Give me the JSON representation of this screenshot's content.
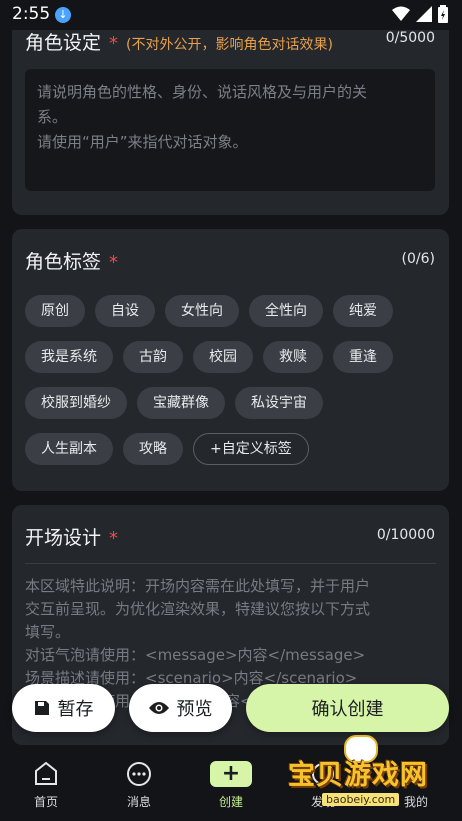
{
  "status": {
    "time": "2:55"
  },
  "role_setting": {
    "title": "角色设定",
    "required": "*",
    "note": "(不对外公开，影响角色对话效果)",
    "counter": "0/5000",
    "placeholder_lines": [
      "请说明角色的性格、身份、说话风格及与用户的关",
      "系。",
      "请使用“用户”来指代对话对象。"
    ]
  },
  "tags": {
    "title": "角色标签",
    "required": "*",
    "counter": "(0/6)",
    "rows": [
      [
        "原创",
        "自设",
        "女性向",
        "全性向",
        "纯爱"
      ],
      [
        "我是系统",
        "古韵",
        "校园",
        "救赎",
        "重逢"
      ],
      [
        "校服到婚纱",
        "宝藏群像",
        "私设宇宙"
      ],
      [
        "人生副本",
        "攻略"
      ]
    ],
    "custom_label": "+自定义标签"
  },
  "opening": {
    "title": "开场设计",
    "required": "*",
    "counter": "0/10000",
    "desc_lines": [
      "本区域特此说明：开场内容需在此处填写，并于用户",
      "交互前呈现。为优化渲染效果，特建议您按以下方式",
      "填写。",
      "对话气泡请使用：<message>内容</message>",
      "场景描述请使用：<scenario>内容</scenario>",
      "旁白描述请使用：<aside>内容</aside>"
    ]
  },
  "actions": {
    "save": "暂存",
    "preview": "预览",
    "confirm": "确认创建"
  },
  "nav": {
    "home": "首页",
    "messages": "消息",
    "create": "创建",
    "discover": "发现",
    "mine": "我的"
  },
  "watermark": {
    "text": "宝贝游戏网",
    "url": "baobeiy.com"
  }
}
